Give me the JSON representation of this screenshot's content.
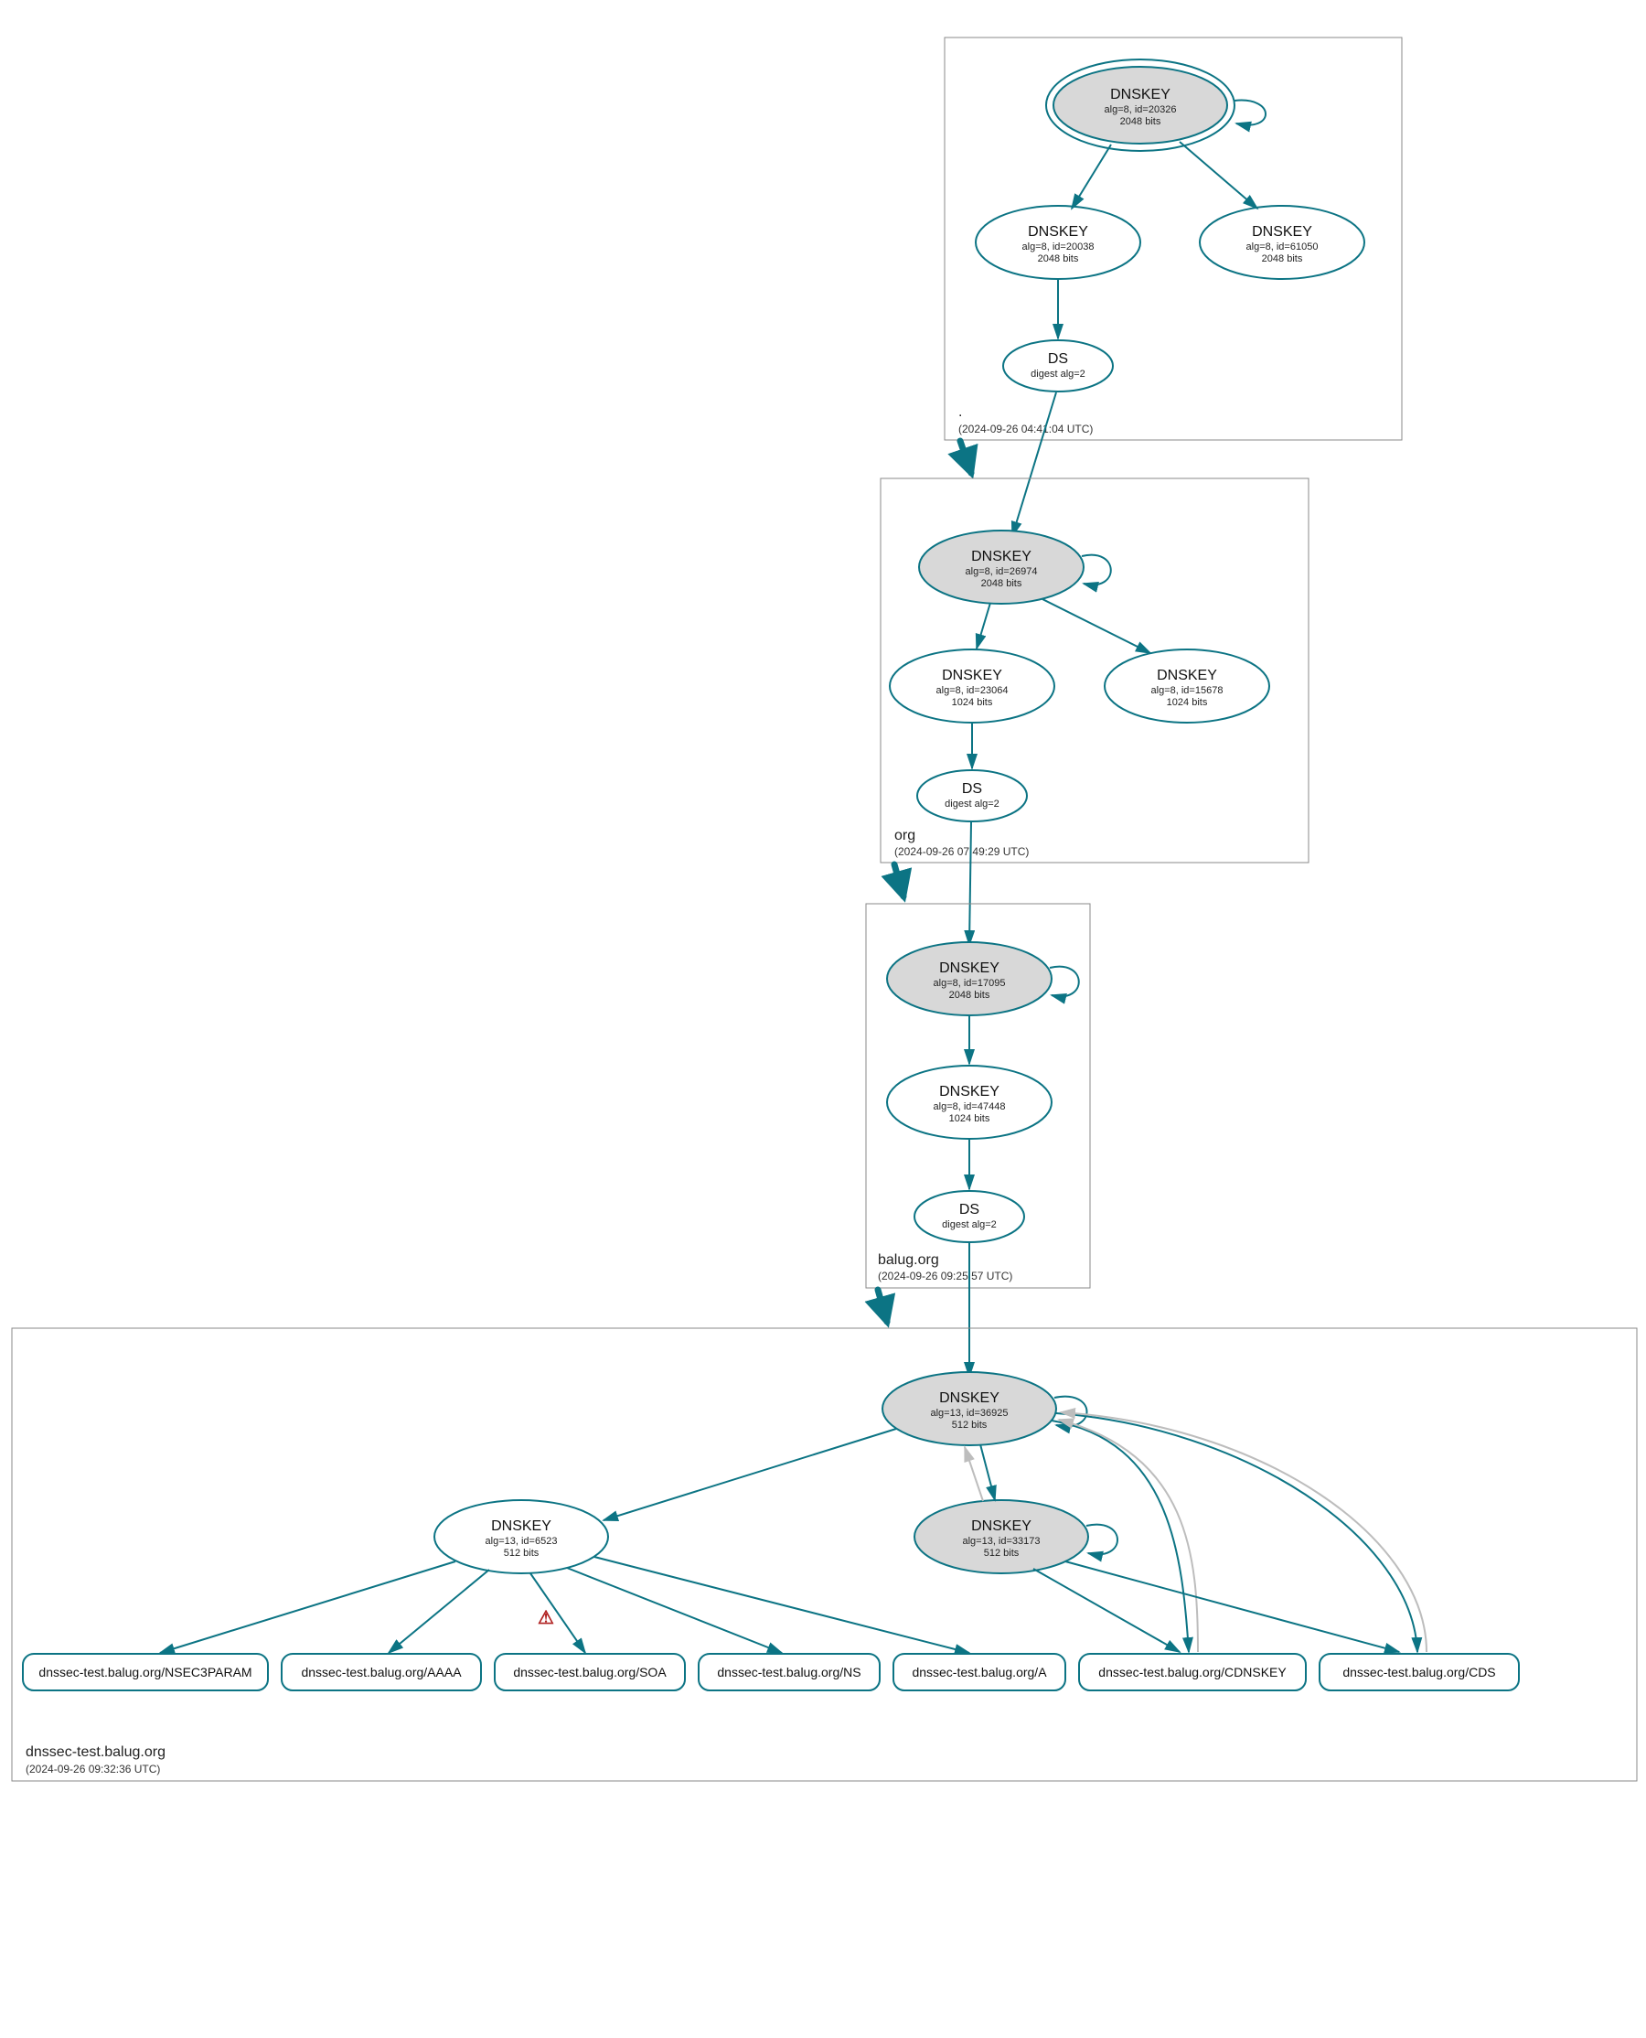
{
  "colors": {
    "accent": "#0c7484",
    "node_grey": "#d8d8d8",
    "box_stroke": "#888888",
    "warn": "#b02121"
  },
  "zones": {
    "root": {
      "label": ".",
      "timestamp": "(2024-09-26 04:41:04 UTC)"
    },
    "org": {
      "label": "org",
      "timestamp": "(2024-09-26 07:49:29 UTC)"
    },
    "balug": {
      "label": "balug.org",
      "timestamp": "(2024-09-26 09:25:57 UTC)"
    },
    "dnssec": {
      "label": "dnssec-test.balug.org",
      "timestamp": "(2024-09-26 09:32:36 UTC)"
    }
  },
  "nodes": {
    "root_ksk": {
      "title": "DNSKEY",
      "line2": "alg=8, id=20326",
      "line3": "2048 bits"
    },
    "root_zsk1": {
      "title": "DNSKEY",
      "line2": "alg=8, id=20038",
      "line3": "2048 bits"
    },
    "root_zsk2": {
      "title": "DNSKEY",
      "line2": "alg=8, id=61050",
      "line3": "2048 bits"
    },
    "root_ds": {
      "title": "DS",
      "line2": "digest alg=2"
    },
    "org_ksk": {
      "title": "DNSKEY",
      "line2": "alg=8, id=26974",
      "line3": "2048 bits"
    },
    "org_zsk1": {
      "title": "DNSKEY",
      "line2": "alg=8, id=23064",
      "line3": "1024 bits"
    },
    "org_zsk2": {
      "title": "DNSKEY",
      "line2": "alg=8, id=15678",
      "line3": "1024 bits"
    },
    "org_ds": {
      "title": "DS",
      "line2": "digest alg=2"
    },
    "balug_ksk": {
      "title": "DNSKEY",
      "line2": "alg=8, id=17095",
      "line3": "2048 bits"
    },
    "balug_zsk": {
      "title": "DNSKEY",
      "line2": "alg=8, id=47448",
      "line3": "1024 bits"
    },
    "balug_ds": {
      "title": "DS",
      "line2": "digest alg=2"
    },
    "dt_ksk": {
      "title": "DNSKEY",
      "line2": "alg=13, id=36925",
      "line3": "512 bits"
    },
    "dt_zsk": {
      "title": "DNSKEY",
      "line2": "alg=13, id=6523",
      "line3": "512 bits"
    },
    "dt_key3": {
      "title": "DNSKEY",
      "line2": "alg=13, id=33173",
      "line3": "512 bits"
    }
  },
  "leaves": {
    "nsec3": "dnssec-test.balug.org/NSEC3PARAM",
    "aaaa": "dnssec-test.balug.org/AAAA",
    "soa": "dnssec-test.balug.org/SOA",
    "ns": "dnssec-test.balug.org/NS",
    "a": "dnssec-test.balug.org/A",
    "cdnskey": "dnssec-test.balug.org/CDNSKEY",
    "cds": "dnssec-test.balug.org/CDS"
  },
  "warning_icon": "⚠"
}
